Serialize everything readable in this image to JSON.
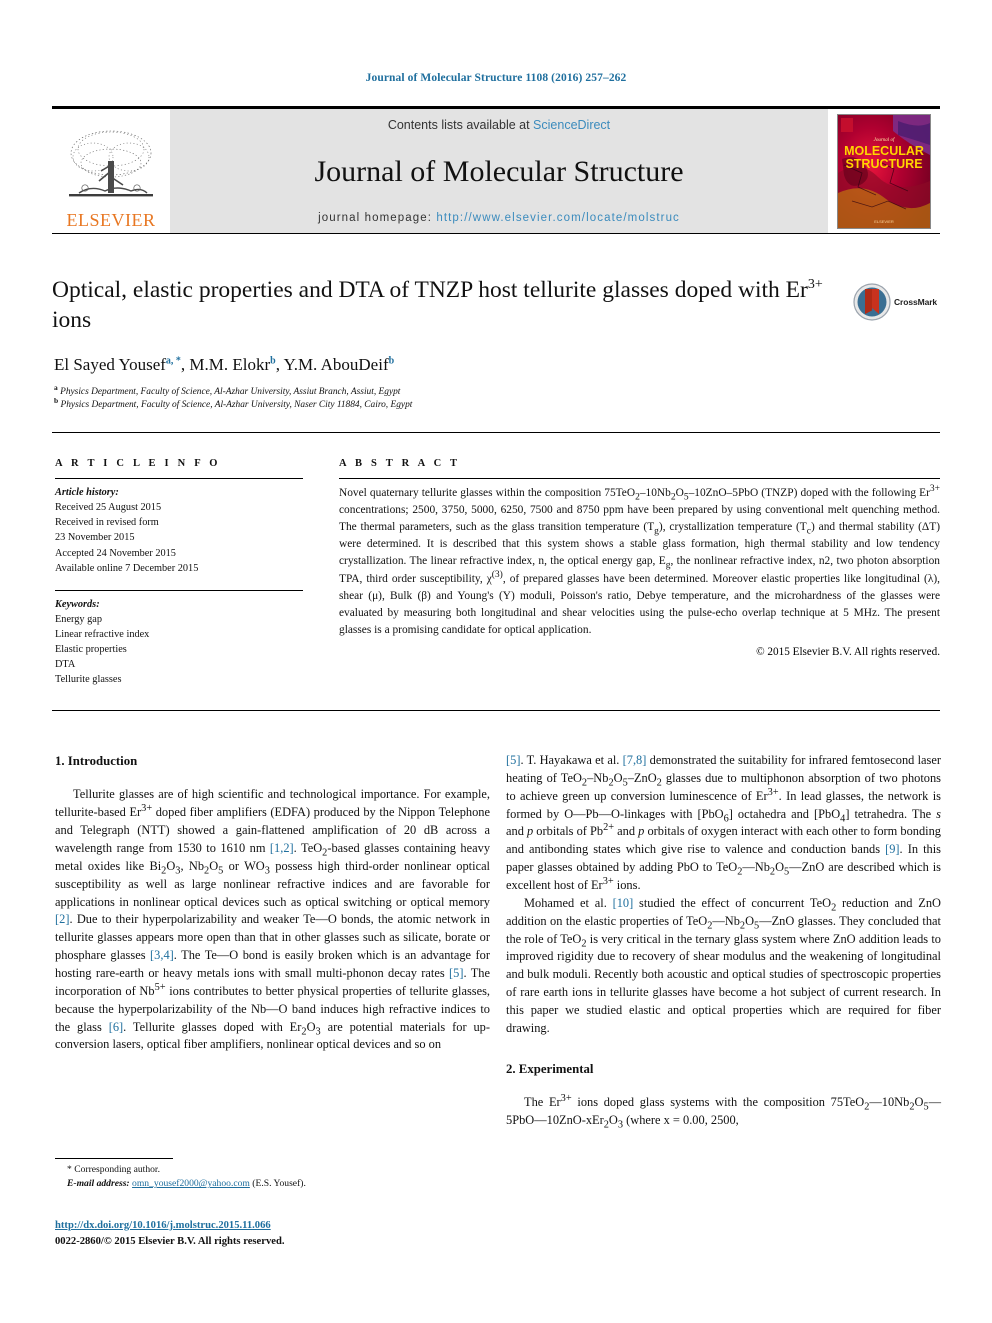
{
  "running_head": "Journal of Molecular Structure 1108 (2016) 257–262",
  "masthead": {
    "contents_prefix": "Contents lists available at ",
    "contents_link": "ScienceDirect",
    "journal_title": "Journal of Molecular Structure",
    "homepage_prefix": "journal homepage: ",
    "homepage_link": "http://www.elsevier.com/locate/molstruc",
    "publisher_word": "ELSEVIER",
    "cover_line1": "MOLECULAR",
    "cover_line2": "STRUCTURE",
    "cover_overline": "Journal of"
  },
  "article": {
    "title_part1": "Optical, elastic properties and DTA of TNZP host tellurite glasses doped",
    "title_part2_pre": "with Er",
    "title_part2_sup": "3+",
    "title_part2_post": " ions",
    "crossmark_label": "CrossMark",
    "authors": [
      {
        "name": "El Sayed Yousef",
        "sup": "a, *"
      },
      {
        "name": "M.M. Elokr",
        "sup": "b"
      },
      {
        "name": "Y.M. AbouDeif",
        "sup": "b"
      }
    ],
    "affiliations": [
      {
        "mark": "a",
        "text": "Physics Department, Faculty of Science, Al-Azhar University, Assiut Branch, Assiut, Egypt"
      },
      {
        "mark": "b",
        "text": "Physics Department, Faculty of Science, Al-Azhar University, Naser City 11884, Cairo, Egypt"
      }
    ]
  },
  "article_info": {
    "heading": "A R T I C L E  I N F O",
    "history_label": "Article history:",
    "history": [
      "Received 25 August 2015",
      "Received in revised form",
      "23 November 2015",
      "Accepted 24 November 2015",
      "Available online 7 December 2015"
    ],
    "keywords_label": "Keywords:",
    "keywords": [
      "Energy gap",
      "Linear refractive index",
      "Elastic properties",
      "DTA",
      "Tellurite glasses"
    ]
  },
  "abstract": {
    "heading": "A B S T R A C T",
    "copyright": "© 2015 Elsevier B.V. All rights reserved."
  },
  "sections": {
    "introduction_heading": "1.  Introduction",
    "experimental_heading": "2.  Experimental"
  },
  "footnote": {
    "corresponding": "* Corresponding author.",
    "email_label": "E-mail address:",
    "email": "omn_yousef2000@yahoo.com",
    "email_owner": "(E.S. Yousef)."
  },
  "doi": {
    "url": "http://dx.doi.org/10.1016/j.molstruc.2015.11.066",
    "issn_line": "0022-2860/© 2015 Elsevier B.V. All rights reserved."
  },
  "colors": {
    "link_blue": "#1f6f9e",
    "sciencedirect_blue": "#3b8bbd",
    "elsevier_orange": "#E87722",
    "band_gray": "#e3e3e3"
  }
}
